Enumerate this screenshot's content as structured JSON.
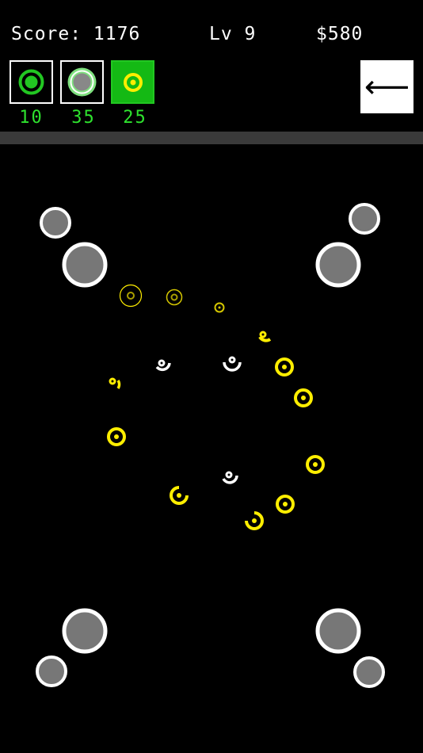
{
  "hud": {
    "score": "Score: 1176",
    "level": "Lv 9",
    "money": "$580"
  },
  "towers": [
    {
      "name": "green-tower",
      "cost": "10",
      "selected": false
    },
    {
      "name": "lightgreen-tower",
      "cost": "35",
      "selected": false
    },
    {
      "name": "yellow-tower",
      "cost": "25",
      "selected": true
    }
  ],
  "back_button": {
    "icon": "left-arrow-icon",
    "glyph": "⟵"
  },
  "colors": {
    "green": "#22c722",
    "light_green": "#7ee07e",
    "yellow": "#ffee00",
    "gray": "#777777",
    "white": "#ffffff",
    "divider": "#3a3a3a"
  }
}
